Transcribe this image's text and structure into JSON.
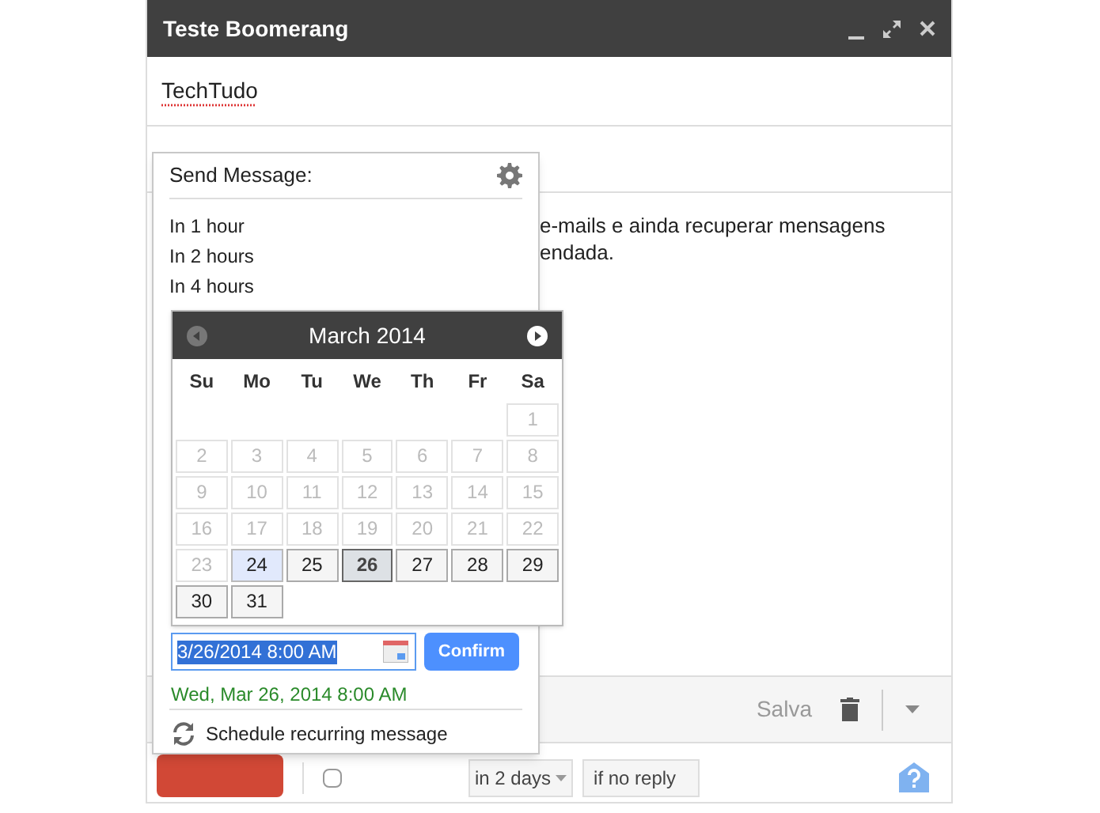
{
  "window": {
    "title": "Teste Boomerang"
  },
  "subject": "TechTudo",
  "body_lines": [
    "e-mails e ainda recuperar mensagens",
    "endada."
  ],
  "toolbar": {
    "saved": "Salva"
  },
  "bottom": {
    "boomerang_checked": false,
    "delay": "in 2 days",
    "condition": "if no reply"
  },
  "popup": {
    "title": "Send Message:",
    "options": [
      "In 1 hour",
      "In 2 hours",
      "In 4 hours"
    ],
    "calendar": {
      "month": "March 2014",
      "weekdays": [
        "Su",
        "Mo",
        "Tu",
        "We",
        "Th",
        "Fr",
        "Sa"
      ],
      "weeks": [
        [
          {
            "kind": "blank"
          },
          {
            "kind": "blank"
          },
          {
            "kind": "blank"
          },
          {
            "kind": "blank"
          },
          {
            "kind": "blank"
          },
          {
            "kind": "blank"
          },
          {
            "day": "1",
            "kind": "past",
            "selected": false
          }
        ],
        [
          {
            "day": "2",
            "kind": "past",
            "selected": false
          },
          {
            "day": "3",
            "kind": "past",
            "selected": false
          },
          {
            "day": "4",
            "kind": "past",
            "selected": false
          },
          {
            "day": "5",
            "kind": "past",
            "selected": false
          },
          {
            "day": "6",
            "kind": "past",
            "selected": false
          },
          {
            "day": "7",
            "kind": "past",
            "selected": false
          },
          {
            "day": "8",
            "kind": "past",
            "selected": false
          }
        ],
        [
          {
            "day": "9",
            "kind": "past",
            "selected": false
          },
          {
            "day": "10",
            "kind": "past",
            "selected": false
          },
          {
            "day": "11",
            "kind": "past",
            "selected": false
          },
          {
            "day": "12",
            "kind": "past",
            "selected": false
          },
          {
            "day": "13",
            "kind": "past",
            "selected": false
          },
          {
            "day": "14",
            "kind": "past",
            "selected": false
          },
          {
            "day": "15",
            "kind": "past",
            "selected": false
          }
        ],
        [
          {
            "day": "16",
            "kind": "past",
            "selected": false
          },
          {
            "day": "17",
            "kind": "past",
            "selected": false
          },
          {
            "day": "18",
            "kind": "past",
            "selected": false
          },
          {
            "day": "19",
            "kind": "past",
            "selected": false
          },
          {
            "day": "20",
            "kind": "past",
            "selected": false
          },
          {
            "day": "21",
            "kind": "past",
            "selected": false
          },
          {
            "day": "22",
            "kind": "past",
            "selected": false
          }
        ],
        [
          {
            "day": "23",
            "kind": "past",
            "selected": false
          },
          {
            "day": "24",
            "kind": "today",
            "selected": false
          },
          {
            "day": "25",
            "kind": "available",
            "selected": false
          },
          {
            "day": "26",
            "kind": "available",
            "selected": true
          },
          {
            "day": "27",
            "kind": "available",
            "selected": false
          },
          {
            "day": "28",
            "kind": "available",
            "selected": false
          },
          {
            "day": "29",
            "kind": "available",
            "selected": false
          }
        ],
        [
          {
            "day": "30",
            "kind": "available",
            "selected": false
          },
          {
            "day": "31",
            "kind": "available",
            "selected": false
          }
        ]
      ]
    },
    "date_value": "3/26/2014 8:00 AM",
    "confirm": "Confirm",
    "preview": "Wed, Mar 26, 2014 8:00 AM",
    "recurring": "Schedule recurring message"
  }
}
